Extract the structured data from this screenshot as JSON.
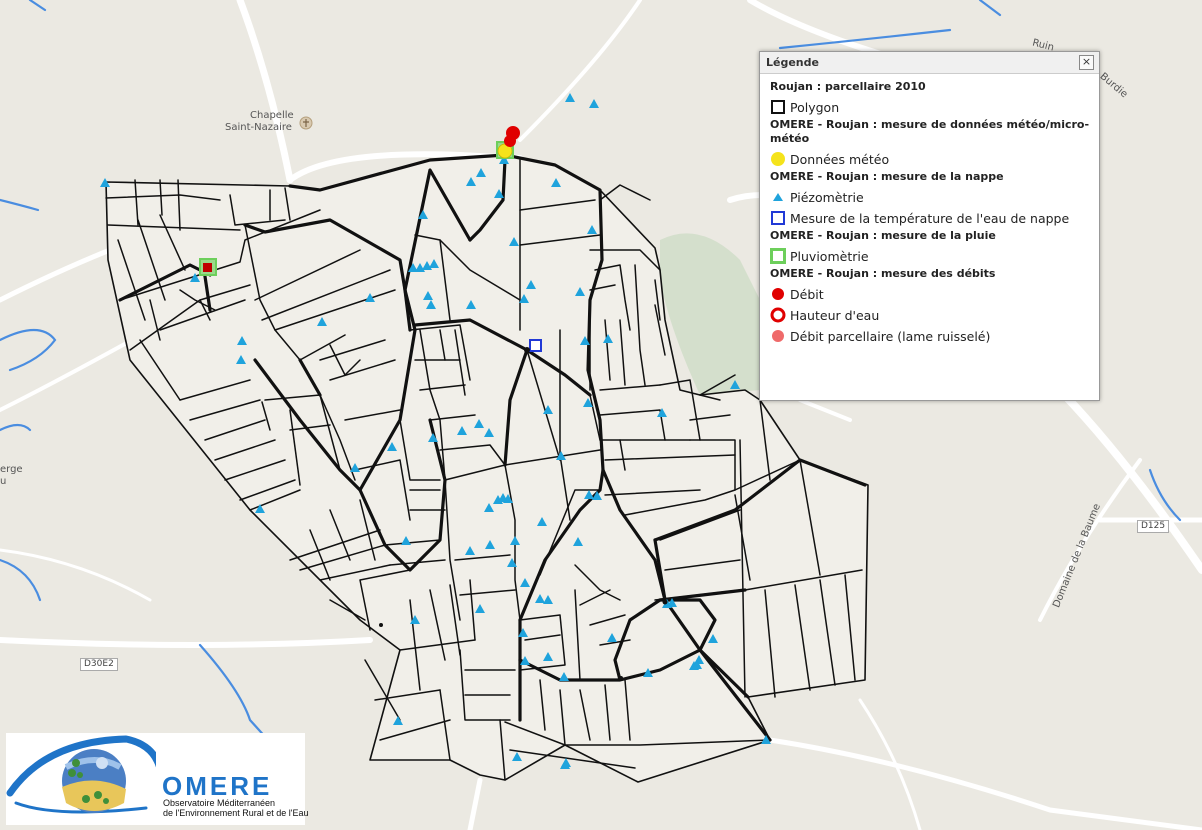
{
  "map": {
    "labels": {
      "chapelle": "Chapelle",
      "saint_nazaire": "Saint-Nazaire",
      "ruin": "Ruin",
      "burdie": "Burdie",
      "road_d125": "D125",
      "road_d30e2": "D30E2",
      "domaine": "Domaine de la Baume",
      "erge": "erge",
      "u": "u"
    }
  },
  "legend": {
    "title": "Légende",
    "close_symbol": "×",
    "sections": [
      {
        "heading": "Roujan : parcellaire 2010",
        "items": [
          {
            "label": "Polygon",
            "symbol": "polygon-square"
          }
        ]
      },
      {
        "heading": "OMERE - Roujan : mesure de données météo/micro-météo",
        "items": [
          {
            "label": "Données météo",
            "symbol": "yellow-circle"
          }
        ]
      },
      {
        "heading": "OMERE - Roujan : mesure de la nappe",
        "items": [
          {
            "label": "Piézomètrie",
            "symbol": "blue-triangle"
          },
          {
            "label": "Mesure de la température de l'eau de nappe",
            "symbol": "blue-square"
          }
        ]
      },
      {
        "heading": "OMERE - Roujan : mesure de la pluie",
        "items": [
          {
            "label": "Pluviomètrie",
            "symbol": "green-square"
          }
        ]
      },
      {
        "heading": "OMERE - Roujan : mesure des débits",
        "items": [
          {
            "label": "Débit",
            "symbol": "red-circle"
          },
          {
            "label": "Hauteur d'eau",
            "symbol": "red-ring"
          },
          {
            "label": "Débit parcellaire (lame ruisselé)",
            "symbol": "pink-circle"
          }
        ]
      }
    ]
  },
  "logo": {
    "name": "OMERE",
    "subtitle_line1": "Observatoire Méditerranéen",
    "subtitle_line2": "de l'Environnement Rural et de l'Eau"
  },
  "colors": {
    "background": "#ebe9e2",
    "parcel_fill": "#f1efe9",
    "piezo": "#1fa3dc",
    "meteo": "#f5e31b",
    "rain": "#6dcf5b",
    "flow": "#e00000",
    "flow_parcel": "#ef6a6a",
    "water_temp": "#2139d6",
    "stream": "#4a8de0",
    "pond": "#8fb6f2"
  }
}
